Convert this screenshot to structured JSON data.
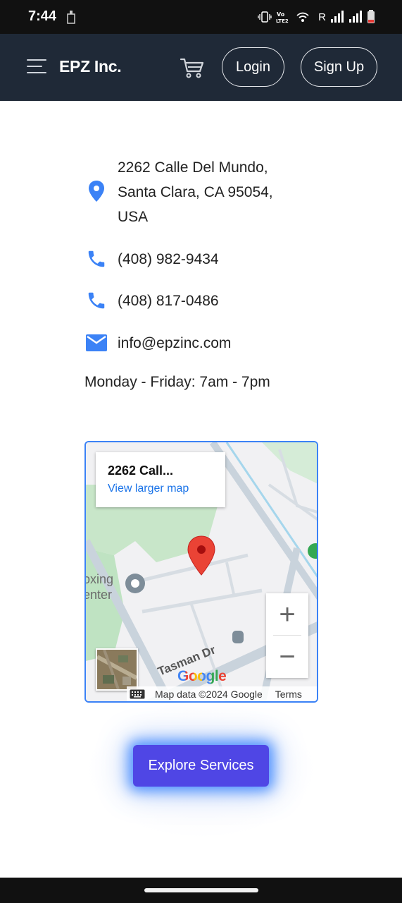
{
  "status_bar": {
    "time": "7:44",
    "carrier_marker": "R",
    "icons": [
      "sim-icon",
      "vibrate-icon",
      "volte-icon",
      "wifi-icon",
      "signal-icon",
      "signal-icon",
      "battery-icon"
    ]
  },
  "header": {
    "brand": "EPZ Inc.",
    "login_label": "Login",
    "signup_label": "Sign Up"
  },
  "contact": {
    "address": "2262 Calle Del Mundo, Santa Clara, CA 95054, USA",
    "phone1": "(408) 982-9434",
    "phone2": "(408) 817-0486",
    "email": "info@epzinc.com",
    "hours": "Monday - Friday: 7am - 7pm"
  },
  "map": {
    "card_title": "2262 Call...",
    "card_link": "View larger map",
    "zoom_in": "+",
    "zoom_out": "−",
    "street_label": "Tasman Dr",
    "poi_label_line1": "oxing",
    "poi_label_line2": "enter",
    "attribution": "Map data ©2024 Google",
    "terms": "Terms",
    "logo": "Google"
  },
  "cta": {
    "explore_label": "Explore Services"
  },
  "colors": {
    "header_bg": "#1f2937",
    "accent_icon": "#3b82f6",
    "button_bg": "#4f46e5",
    "map_pin": "#ea4335"
  }
}
